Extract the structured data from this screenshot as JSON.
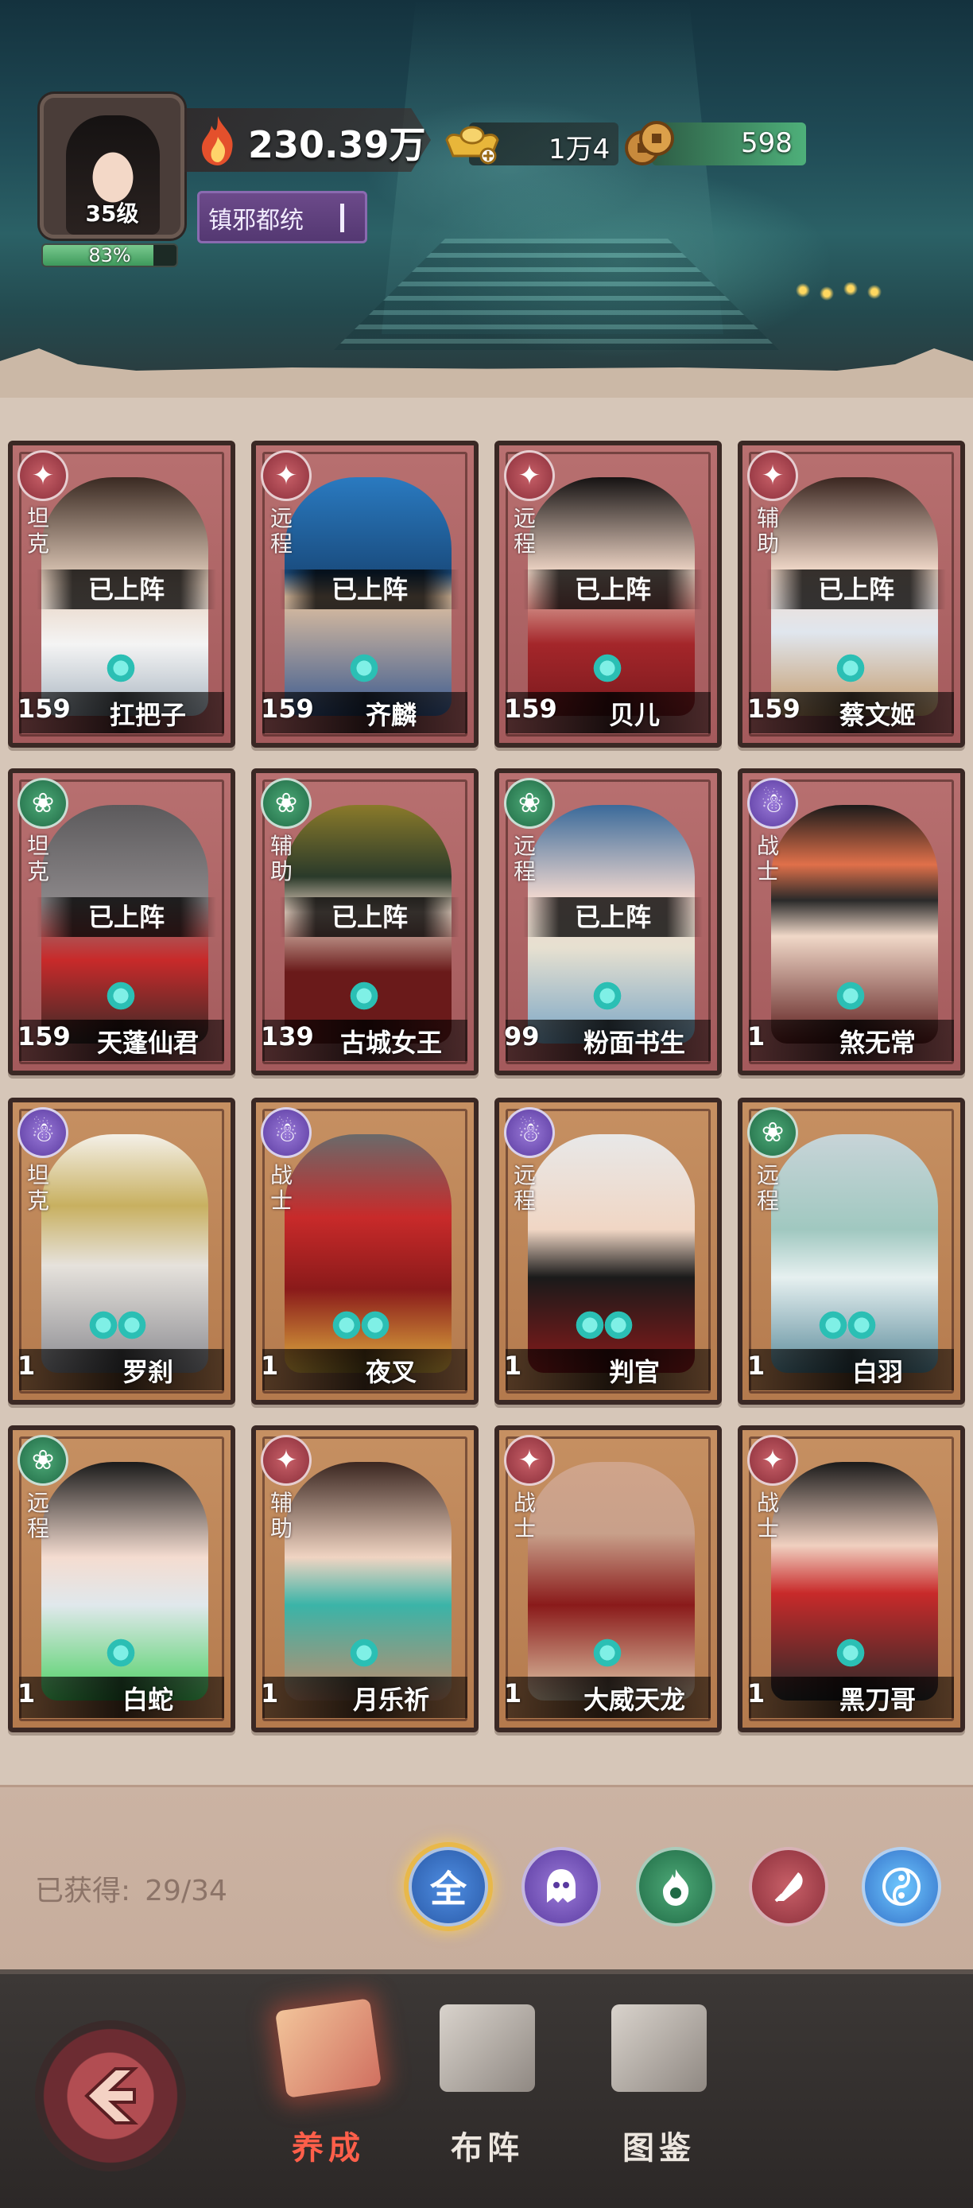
{
  "header": {
    "avatar_level": "35级",
    "exp_percent_text": "83%",
    "exp_fraction": 0.83,
    "power": "230.39万",
    "title": "镇邪都统",
    "ingots": "1万4",
    "coins": "598"
  },
  "heroes": [
    {
      "role": "坦克",
      "status": "已上阵",
      "level": "159",
      "name": "扛把子",
      "faction": "red"
    },
    {
      "role": "远程",
      "status": "已上阵",
      "level": "159",
      "name": "齐麟",
      "faction": "red"
    },
    {
      "role": "远程",
      "status": "已上阵",
      "level": "159",
      "name": "贝儿",
      "faction": "red"
    },
    {
      "role": "辅助",
      "status": "已上阵",
      "level": "159",
      "name": "蔡文姬",
      "faction": "red"
    },
    {
      "role": "坦克",
      "status": "已上阵",
      "level": "159",
      "name": "天蓬仙君",
      "faction": "green"
    },
    {
      "role": "辅助",
      "status": "已上阵",
      "level": "139",
      "name": "古城女王",
      "faction": "green"
    },
    {
      "role": "远程",
      "status": "已上阵",
      "level": "99",
      "name": "粉面书生",
      "faction": "green"
    },
    {
      "role": "战士",
      "status": "",
      "level": "1",
      "name": "煞无常",
      "faction": "purple"
    },
    {
      "role": "坦克",
      "status": "",
      "level": "1",
      "name": "罗刹",
      "faction": "purple"
    },
    {
      "role": "战士",
      "status": "",
      "level": "1",
      "name": "夜叉",
      "faction": "purple"
    },
    {
      "role": "远程",
      "status": "",
      "level": "1",
      "name": "判官",
      "faction": "purple"
    },
    {
      "role": "远程",
      "status": "",
      "level": "1",
      "name": "白羽",
      "faction": "green"
    },
    {
      "role": "远程",
      "status": "",
      "level": "1",
      "name": "白蛇",
      "faction": "green"
    },
    {
      "role": "辅助",
      "status": "",
      "level": "1",
      "name": "月乐祈",
      "faction": "red"
    },
    {
      "role": "战士",
      "status": "",
      "level": "1",
      "name": "大威天龙",
      "faction": "red"
    },
    {
      "role": "战士",
      "status": "",
      "level": "1",
      "name": "黑刀哥",
      "faction": "red"
    }
  ],
  "filter": {
    "obtained_label": "已获得:",
    "obtained_count": "29/34",
    "all_label": "全"
  },
  "nav": {
    "cultivate": "养成",
    "formation": "布阵",
    "codex": "图鉴"
  },
  "colors": {
    "faction_red": "#8a2e3a",
    "faction_green": "#1f6a45",
    "faction_purple": "#5a3aa0",
    "active_nav": "#ff5f4a"
  }
}
